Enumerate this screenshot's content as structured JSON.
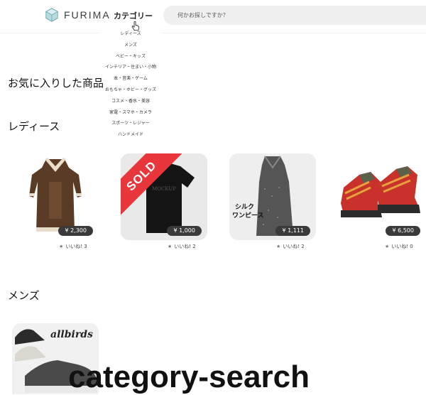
{
  "header": {
    "logo_text": "FURIMA",
    "category_label": "カテゴリー",
    "search_placeholder": "何かお探しですか？"
  },
  "category_menu": {
    "items": [
      "レディース",
      "メンズ",
      "ベビー・キッズ",
      "インテリア・住まい・小物",
      "本・音楽・ゲーム",
      "おもちゃ・ホビー・グッズ",
      "コスメ・香水・美容",
      "家電・スマホ・カメラ",
      "スポーツ・レジャー",
      "ハンドメイド"
    ]
  },
  "favorites": {
    "title": "お気に入りした商品"
  },
  "ladies": {
    "title": "レディース",
    "items": [
      {
        "price": "¥ 2,300",
        "likes": "いいね! 3",
        "image": "brown-dress"
      },
      {
        "price": "¥ 1,000",
        "likes": "いいね! 2",
        "image": "black-tshirt",
        "badge": "SOLD",
        "print_text": "MOCKUP"
      },
      {
        "price": "¥ 1,111",
        "likes": "いいね! 2",
        "image": "silk-dress",
        "caption_line1": "シルク",
        "caption_line2": "ワンピース"
      },
      {
        "price": "¥ 6,500",
        "likes": "いいね! 0",
        "image": "hiking-boots"
      }
    ]
  },
  "mens": {
    "title": "メンズ",
    "items": [
      {
        "image": "allbirds-sneakers",
        "brand_text": "allbirds"
      }
    ]
  },
  "overlay": {
    "label": "category-search"
  },
  "colors": {
    "sold": "#e8363b",
    "pill": "#3a3a3a",
    "search_bg": "#f0f0f0"
  }
}
